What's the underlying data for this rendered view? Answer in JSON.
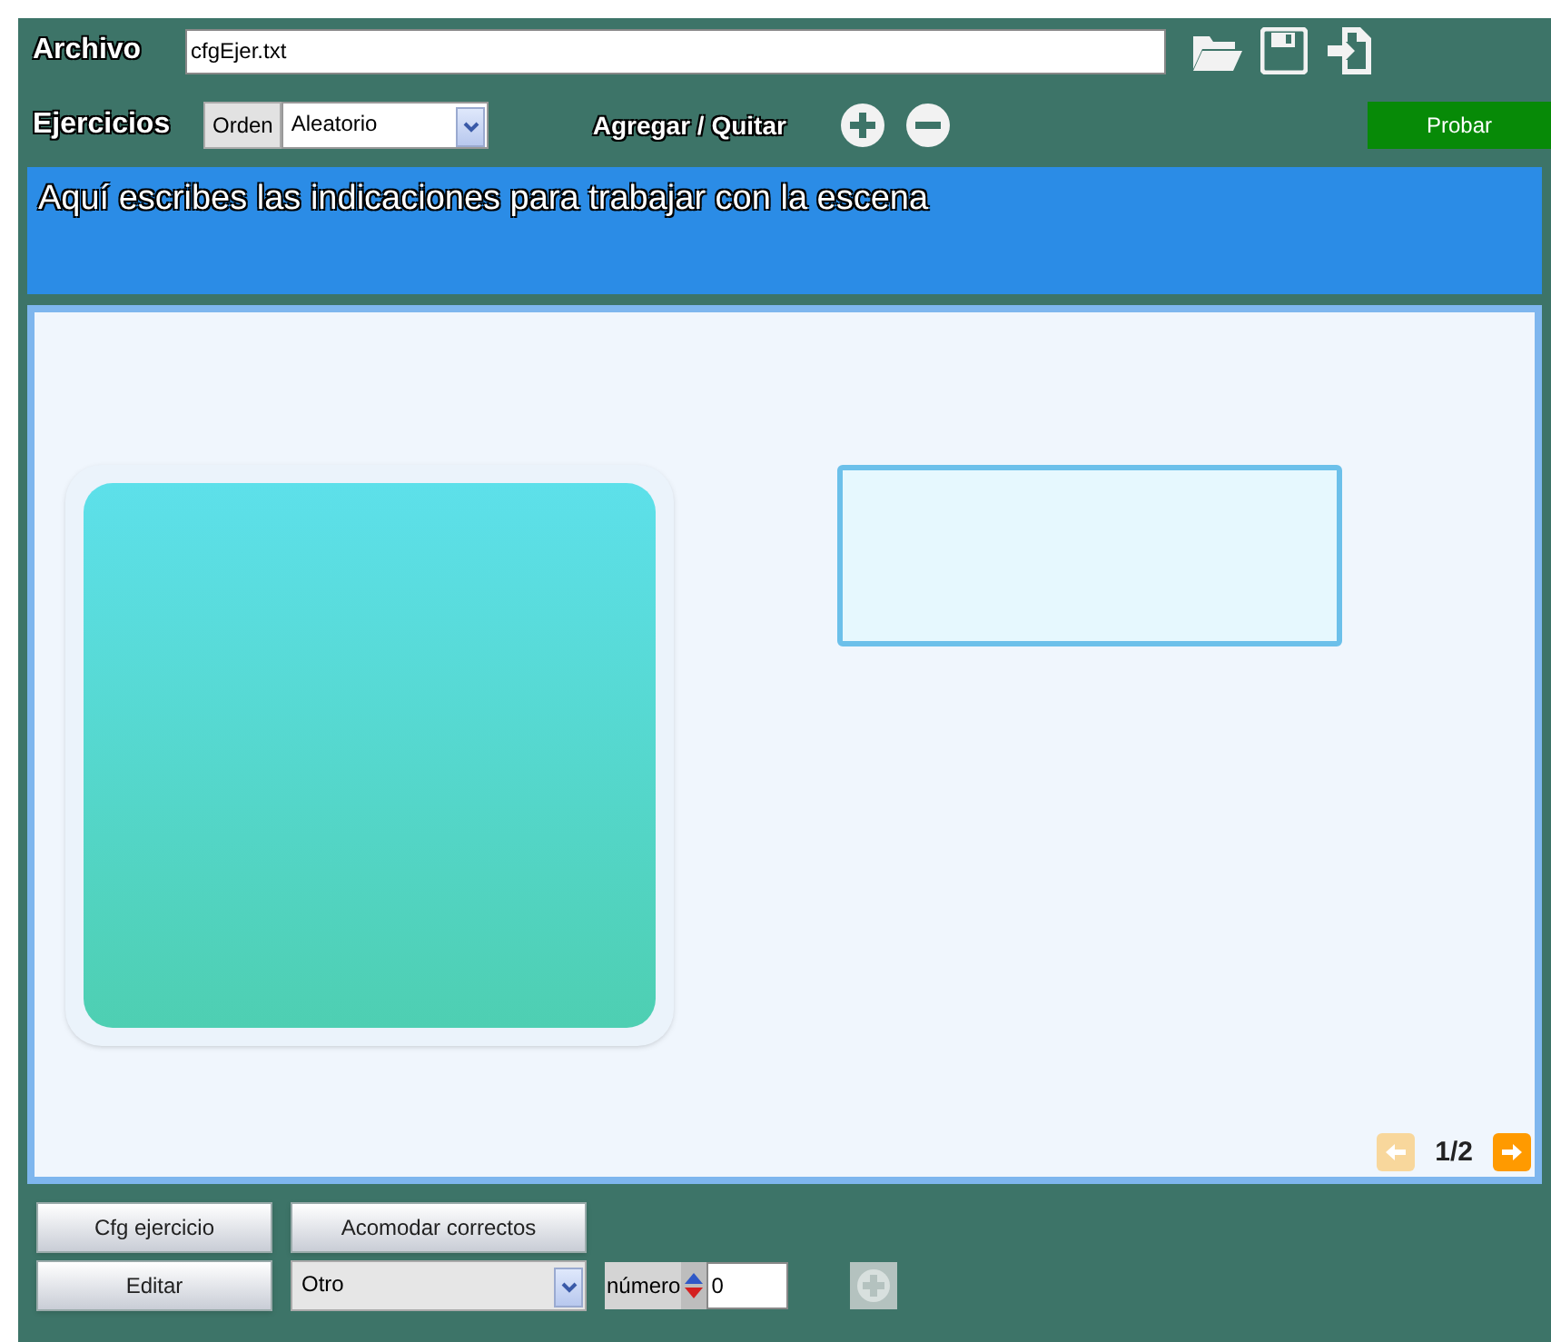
{
  "file_bar": {
    "label": "Archivo",
    "filename": "cfgEjer.txt"
  },
  "exercise_bar": {
    "label": "Ejercicios",
    "order_label": "Orden",
    "order_value": "Aleatorio",
    "add_remove_label": "Agregar / Quitar",
    "test_button": "Probar"
  },
  "instructions": "Aquí escribes las indicaciones para trabajar con la escena",
  "pager": {
    "text": "1/2",
    "prev_enabled": false,
    "next_enabled": true
  },
  "bottom_bar": {
    "buttons": [
      "Cfg ejercicio",
      "Acomodar correctos"
    ],
    "edit_button": "Editar",
    "type_value": "Otro",
    "number_label": "número",
    "number_value": "0",
    "add_enabled": false
  }
}
